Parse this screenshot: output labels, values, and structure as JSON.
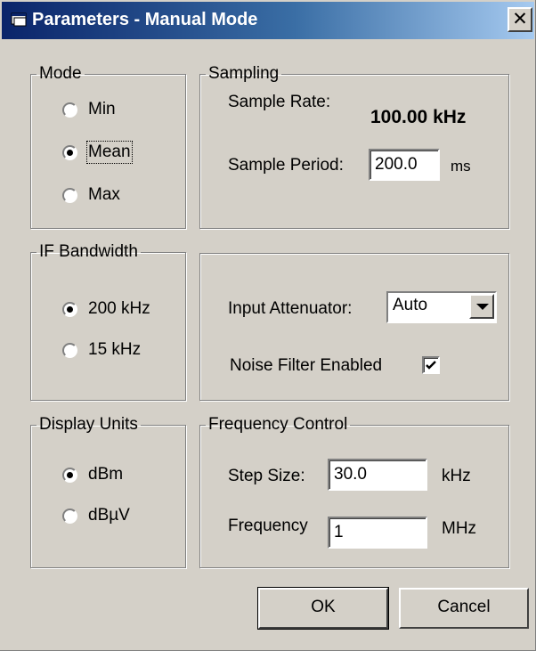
{
  "window": {
    "title": "Parameters - Manual Mode",
    "close_glyph": "✕",
    "icon": "window-icon",
    "close_icon": "close-icon"
  },
  "mode": {
    "label": "Mode",
    "options": [
      {
        "label": "Min",
        "checked": false
      },
      {
        "label": "Mean",
        "checked": true
      },
      {
        "label": "Max",
        "checked": false
      }
    ]
  },
  "sampling": {
    "label": "Sampling",
    "rate_label": "Sample Rate:",
    "rate_value": "100.00 kHz",
    "period_label": "Sample Period:",
    "period_value": "200.0",
    "period_unit": "ms"
  },
  "if_bandwidth": {
    "label": "IF Bandwidth",
    "options": [
      {
        "label": "200 kHz",
        "checked": true
      },
      {
        "label": "15 kHz",
        "checked": false
      }
    ]
  },
  "input": {
    "attenuator_label": "Input Attenuator:",
    "attenuator_value": "Auto",
    "noise_filter_label": "Noise Filter Enabled",
    "noise_filter_checked": true
  },
  "display_units": {
    "label": "Display Units",
    "options": [
      {
        "label": "dBm",
        "checked": true
      },
      {
        "label": "dBµV",
        "checked": false
      }
    ]
  },
  "frequency_control": {
    "label": "Frequency Control",
    "step_label": "Step Size:",
    "step_value": "30.0",
    "step_unit": "kHz",
    "freq_label": "Frequency",
    "freq_value": "1",
    "freq_unit": "MHz"
  },
  "buttons": {
    "ok": "OK",
    "cancel": "Cancel"
  }
}
